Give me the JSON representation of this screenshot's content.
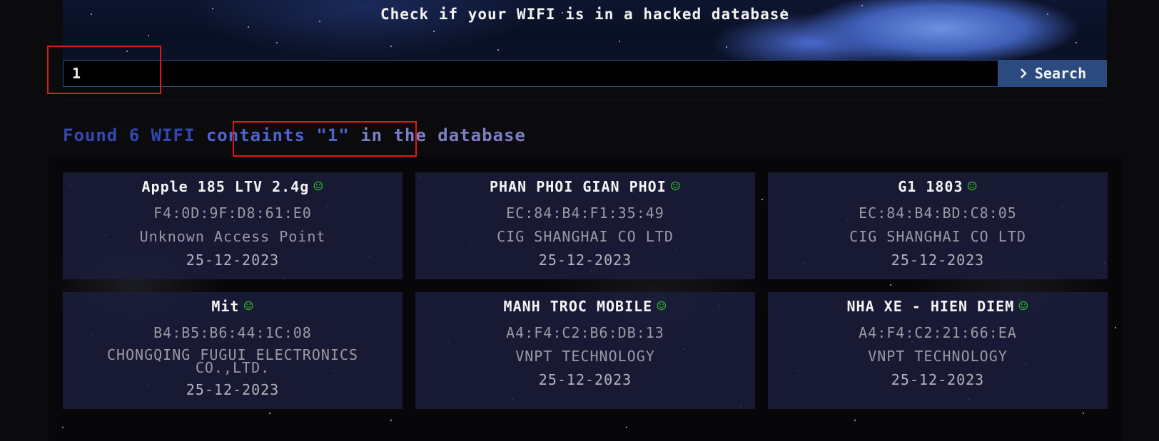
{
  "header": {
    "title": "Check if your WIFI is in a hacked database"
  },
  "search": {
    "value": "1",
    "button_label": "Search",
    "button_icon": "chevron-right-icon"
  },
  "results_summary": {
    "prefix": "Found 6 WIFI ",
    "query_part": "containts \"1\"",
    "suffix": " in the database"
  },
  "results": [
    {
      "name": "Apple 185 LTV 2.4g",
      "mac": "F4:0D:9F:D8:61:E0",
      "vendor": "Unknown Access Point",
      "date": "25-12-2023",
      "status_icon": "smiley-icon"
    },
    {
      "name": "PHAN PHOI GIAN PHOI",
      "mac": "EC:84:B4:F1:35:49",
      "vendor": "CIG SHANGHAI CO LTD",
      "date": "25-12-2023",
      "status_icon": "smiley-icon"
    },
    {
      "name": "G1 1803",
      "mac": "EC:84:B4:BD:C8:05",
      "vendor": "CIG SHANGHAI CO LTD",
      "date": "25-12-2023",
      "status_icon": "smiley-icon"
    },
    {
      "name": "Mit",
      "mac": "B4:B5:B6:44:1C:08",
      "vendor": "CHONGQING FUGUI ELECTRONICS CO.,LTD.",
      "date": "25-12-2023",
      "status_icon": "smiley-icon"
    },
    {
      "name": "MANH TROC MOBILE",
      "mac": "A4:F4:C2:B6:DB:13",
      "vendor": "VNPT TECHNOLOGY",
      "date": "25-12-2023",
      "status_icon": "smiley-icon"
    },
    {
      "name": "NHA XE - HIEN DIEM",
      "mac": "A4:F4:C2:21:66:EA",
      "vendor": "VNPT TECHNOLOGY",
      "date": "25-12-2023",
      "status_icon": "smiley-icon"
    }
  ],
  "colors": {
    "summary_text": "#3348b4",
    "search_button": "#2b4b7e",
    "highlight_box": "#e01818",
    "status_icon": "#28b428"
  }
}
